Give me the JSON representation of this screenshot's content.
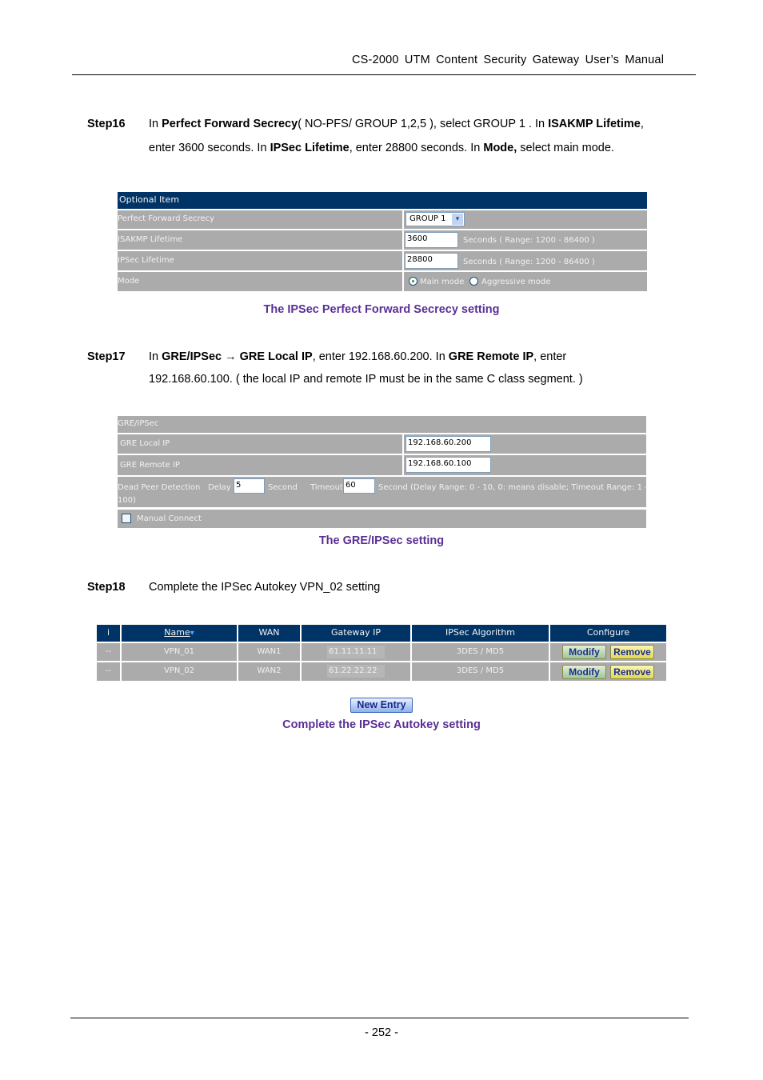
{
  "header": {
    "title": "CS-2000  UTM  Content  Security  Gateway  User’s  Manual"
  },
  "footer": {
    "page_number": "- 252 -"
  },
  "step16": {
    "label": "Step16",
    "line1": [
      {
        "t": "In ",
        "b": false
      },
      {
        "t": "Perfect Forward Secrecy",
        "b": true
      },
      {
        "t": "( NO-PFS/ GROUP 1,2,5 ), select GROUP 1 . In ",
        "b": false
      },
      {
        "t": "ISAKMP Lifetime",
        "b": true
      },
      {
        "t": ",",
        "b": false
      }
    ],
    "line2": [
      {
        "t": "enter 3600 seconds.    In ",
        "b": false
      },
      {
        "t": "IPSec Lifetime",
        "b": true
      },
      {
        "t": ", enter 28800 seconds. In ",
        "b": false
      },
      {
        "t": "Mode,",
        "b": true
      },
      {
        "t": " select main mode.",
        "b": false
      }
    ]
  },
  "optional_panel": {
    "header": "Optional Item",
    "pfs_label": "Perfect Forward Secrecy",
    "pfs_value": "GROUP 1",
    "pfs_arrow": "▾",
    "isakmp_label": "ISAKMP Lifetime",
    "isakmp_value": "3600",
    "isakmp_hint": "Seconds  ( Range: 1200 - 86400 )",
    "ipsec_label": "IPSec Lifetime",
    "ipsec_value": "28800",
    "ipsec_hint": "Seconds  ( Range: 1200 - 86400 )",
    "mode_label": "Mode",
    "mode_main": "Main mode",
    "mode_aggressive": "Aggressive mode",
    "mode_selected": "main"
  },
  "caption1": "The IPSec Perfect Forward Secrecy setting",
  "step17": {
    "label": "Step17",
    "line1": [
      {
        "t": "In ",
        "b": false
      },
      {
        "t": "GRE/IPSec → GRE Local IP",
        "b": true
      },
      {
        "t": ", enter 192.168.60.200. In ",
        "b": false
      },
      {
        "t": "GRE Remote IP",
        "b": true
      },
      {
        "t": ", enter",
        "b": false
      }
    ],
    "line2": [
      {
        "t": "192.168.60.100. ( the local IP and remote IP must be in the same C class segment. )",
        "b": false
      }
    ]
  },
  "gre_panel": {
    "header": "GRE/IPSec",
    "local_label": "GRE Local IP",
    "local_value": "192.168.60.200",
    "remote_label": "GRE Remote IP",
    "remote_value": "192.168.60.100",
    "dpd_label": "Dead Peer Detection",
    "delay_label": "Delay",
    "delay_value": "5",
    "second1": "Second",
    "timeout_label": "Timeout",
    "timeout_value": "60",
    "dpd_hint": "Second (Delay Range: 0 - 10, 0: means disable; Timeout Range: 1 -",
    "dpd_hint2": "100)",
    "manual_connect": "Manual Connect",
    "manual_checked": false
  },
  "caption2": "The GRE/IPSec setting",
  "step18": {
    "label": "Step18",
    "text": "Complete the IPSec Autokey VPN_02 setting"
  },
  "vpn_table": {
    "columns": [
      "i",
      "Name",
      "WAN",
      "Gateway IP",
      "IPSec Algorithm",
      "Configure"
    ],
    "sort_icon": "▾",
    "rows": [
      {
        "i": "--",
        "name": "VPN_01",
        "wan": "WAN1",
        "gateway": "61.11.11.11",
        "algorithm": "3DES / MD5"
      },
      {
        "i": "--",
        "name": "VPN_02",
        "wan": "WAN2",
        "gateway": "61.22.22.22",
        "algorithm": "3DES / MD5"
      }
    ],
    "modify_label": "Modify",
    "remove_label": "Remove",
    "new_entry_label": "New  Entry"
  },
  "caption3": "Complete the IPSec Autokey setting"
}
